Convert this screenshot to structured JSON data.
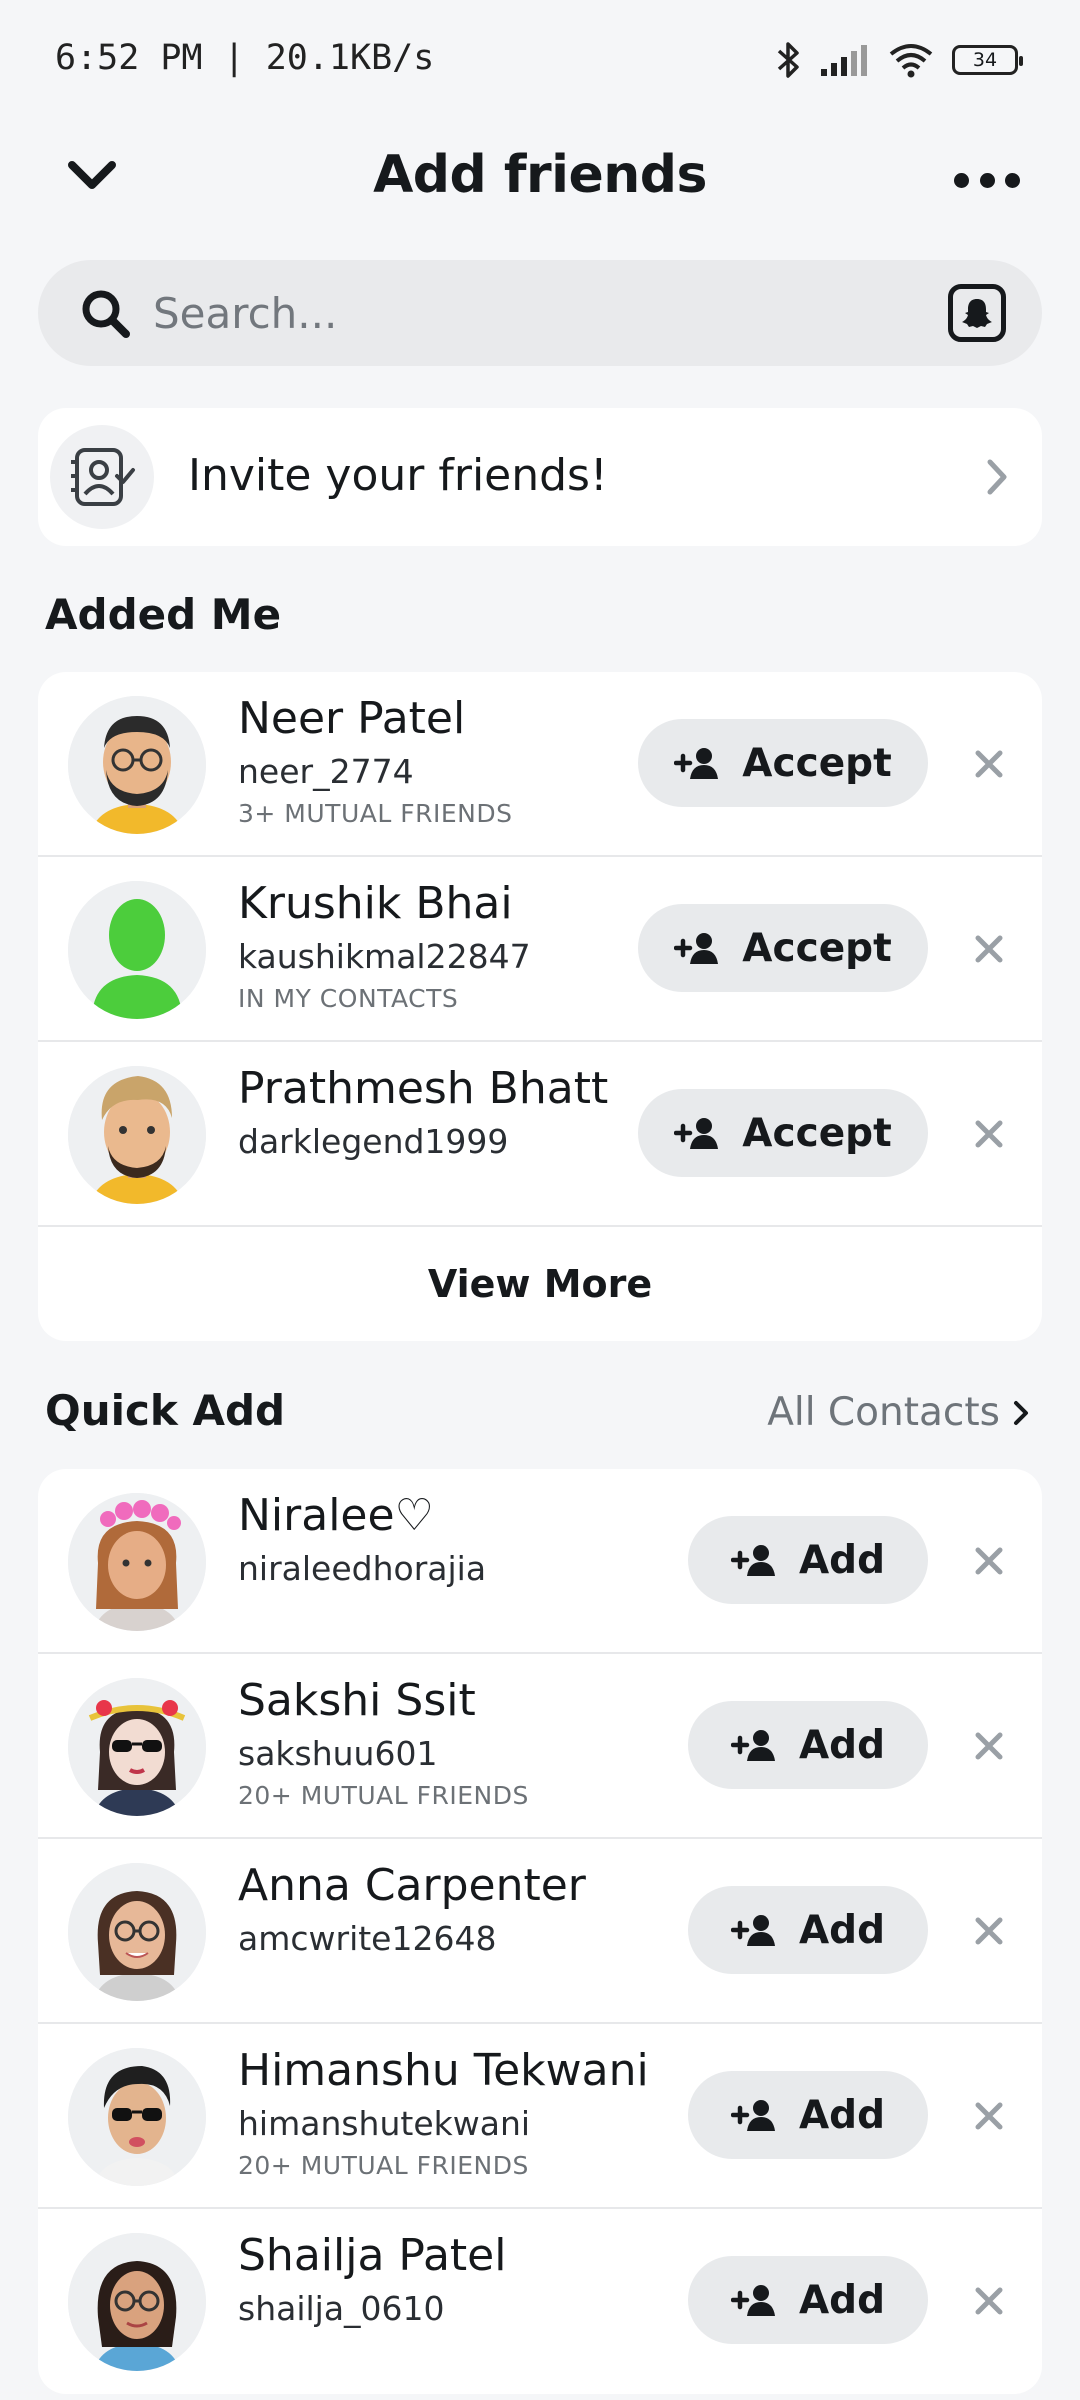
{
  "status_bar": {
    "time": "6:52 PM | 20.1KB/s",
    "battery": "34"
  },
  "header": {
    "title": "Add friends"
  },
  "search": {
    "placeholder": "Search..."
  },
  "invite": {
    "label": "Invite your friends!"
  },
  "added_me": {
    "title": "Added Me",
    "button_label": "Accept",
    "view_more": "View More",
    "items": [
      {
        "name": "Neer Patel",
        "username": "neer_2774",
        "sub": "3+ MUTUAL FRIENDS"
      },
      {
        "name": "Krushik Bhai",
        "username": "kaushikmal22847",
        "sub": "IN MY CONTACTS"
      },
      {
        "name": "Prathmesh Bhatt",
        "username": "darklegend1999",
        "sub": ""
      }
    ]
  },
  "quick_add": {
    "title": "Quick Add",
    "all_contacts": "All Contacts",
    "button_label": "Add",
    "items": [
      {
        "name": "Niralee♡",
        "username": "niraleedhorajia",
        "sub": ""
      },
      {
        "name": "Sakshi Ssit",
        "username": "sakshuu601",
        "sub": "20+ MUTUAL FRIENDS"
      },
      {
        "name": "Anna Carpenter",
        "username": "amcwrite12648",
        "sub": ""
      },
      {
        "name": "Himanshu Tekwani",
        "username": "himanshutekwani",
        "sub": "20+ MUTUAL FRIENDS"
      },
      {
        "name": "Shailja Patel",
        "username": "shailja_0610",
        "sub": ""
      }
    ]
  },
  "colors": {
    "background": "#f5f6f8",
    "card": "#ffffff",
    "pill": "#e8eaec",
    "secondary_text": "#6c7176",
    "silhouette_green": "#4ccd3c"
  }
}
